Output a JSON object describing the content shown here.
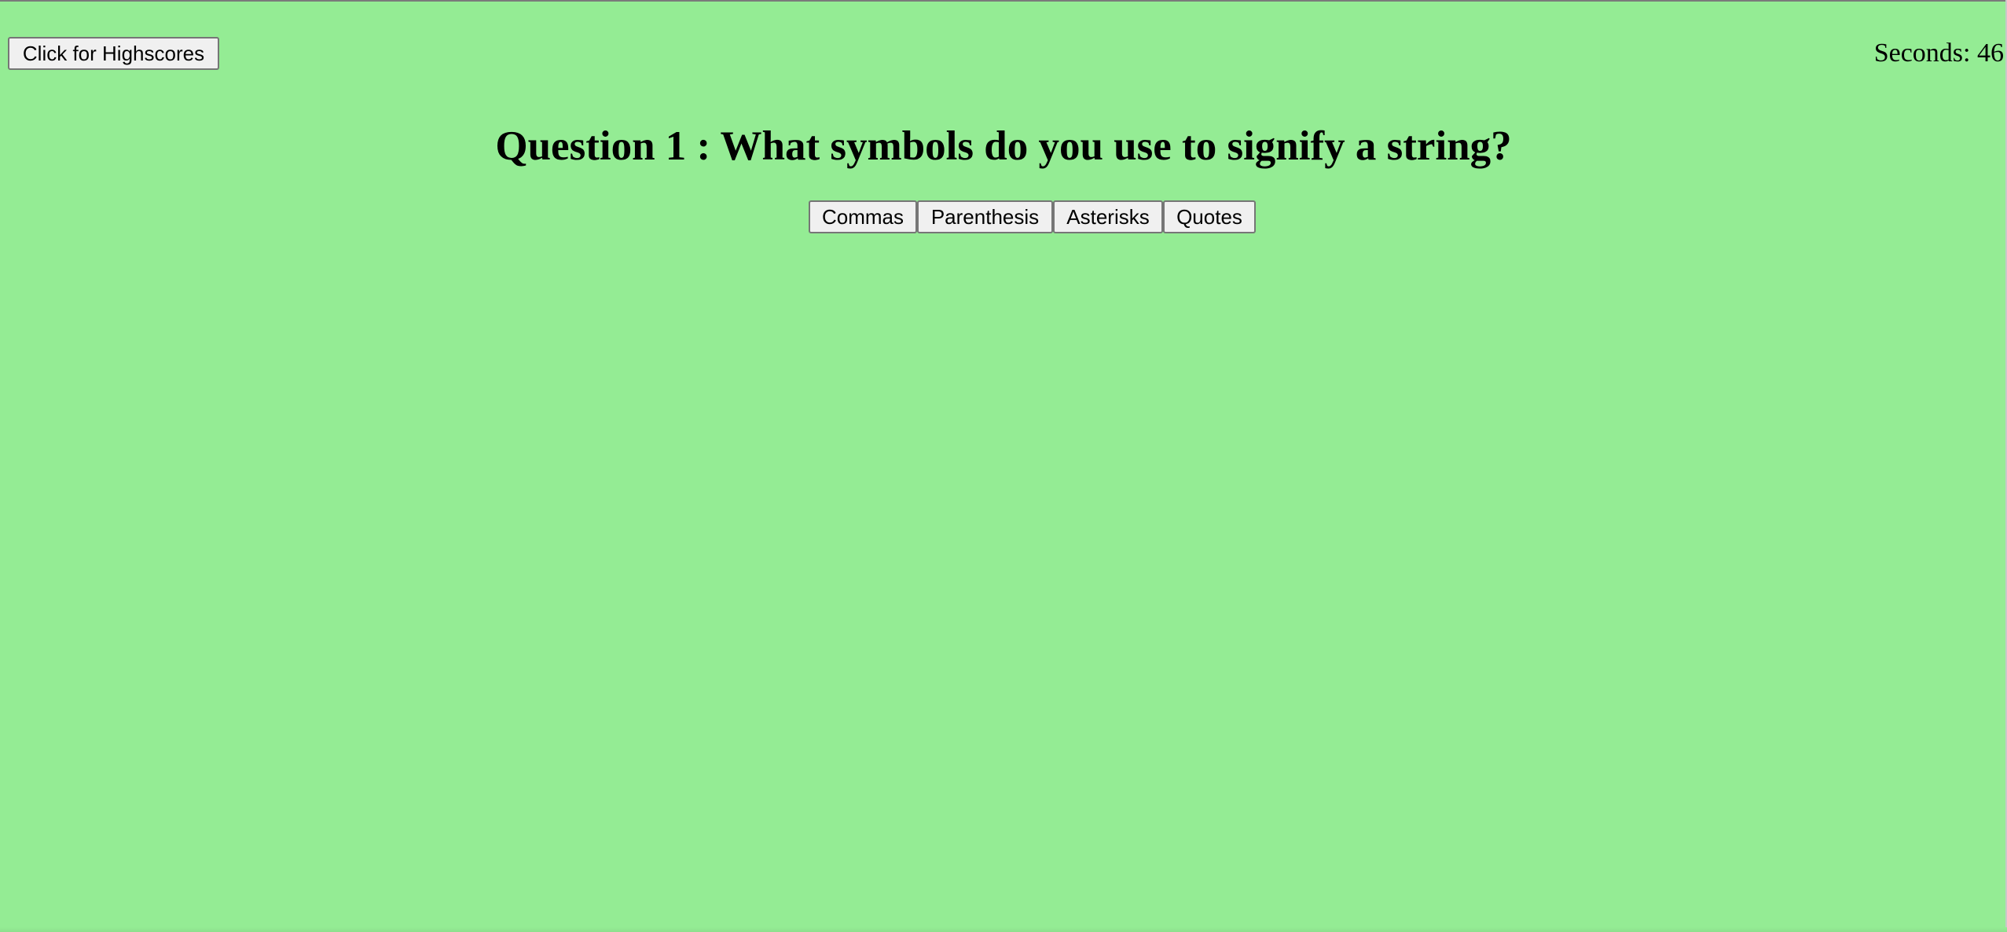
{
  "header": {
    "highscores_label": "Click for Highscores",
    "timer_text": "Seconds: 46"
  },
  "quiz": {
    "question": "Question 1 : What symbols do you use to signify a string?",
    "answers": [
      "Commas",
      "Parenthesis",
      "Asterisks",
      "Quotes"
    ]
  },
  "colors": {
    "background": "#94ec94",
    "button_bg": "#f0f0f0",
    "button_border": "#767676"
  }
}
